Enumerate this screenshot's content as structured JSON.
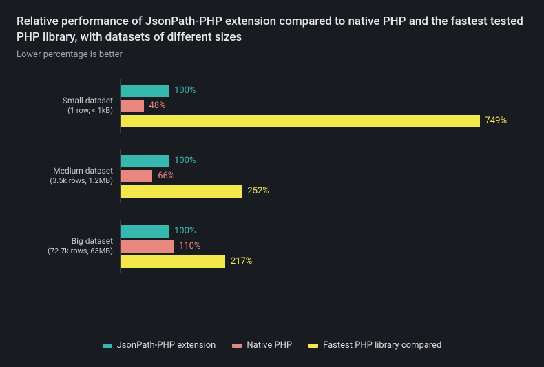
{
  "title": "Relative performance of JsonPath-PHP extension compared to native PHP and the fastest tested PHP library, with datasets of different sizes",
  "subtitle": "Lower percentage is better",
  "legend": [
    {
      "name": "JsonPath-PHP extension",
      "color": "#37b8af"
    },
    {
      "name": "Native PHP",
      "color": "#e8877f"
    },
    {
      "name": "Fastest PHP library compared",
      "color": "#f2e84c"
    }
  ],
  "chart_data": {
    "type": "bar",
    "orientation": "horizontal",
    "xlabel": "",
    "ylabel": "",
    "xlim": [
      0,
      800
    ],
    "categories": [
      {
        "label": "Small dataset",
        "sublabel": "(1 row, < 1kB)"
      },
      {
        "label": "Medium dataset",
        "sublabel": "(3.5k rows, 1.2MB)"
      },
      {
        "label": "Big dataset",
        "sublabel": "(72.7k rows, 63MB)"
      }
    ],
    "series": [
      {
        "name": "JsonPath-PHP extension",
        "values": [
          100,
          100,
          100
        ]
      },
      {
        "name": "Native PHP",
        "values": [
          48,
          66,
          110
        ]
      },
      {
        "name": "Fastest PHP library compared",
        "values": [
          749,
          252,
          217
        ]
      }
    ],
    "value_suffix": "%"
  }
}
